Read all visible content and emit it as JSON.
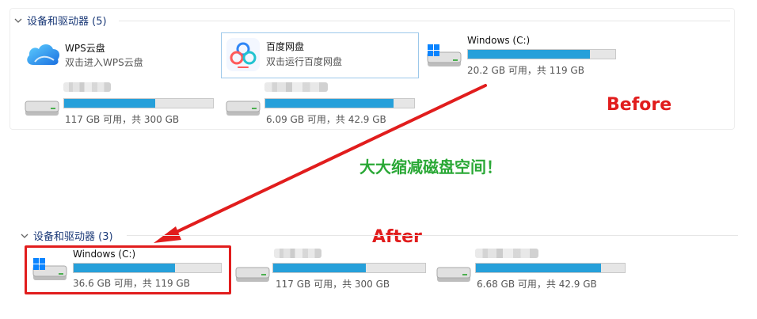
{
  "top_section": {
    "header": "设备和驱动器 (5)",
    "items": [
      {
        "name": "WPS云盘",
        "sub": "双击进入WPS云盘",
        "icon": "wps-cloud-icon"
      },
      {
        "name": "百度网盘",
        "sub": "双击运行百度网盘",
        "icon": "baidu-netdisk-icon"
      },
      {
        "name": "Windows (C:)",
        "space": "20.2 GB 可用，共 119 GB",
        "used_fraction": 0.83,
        "icon": "windows-drive-icon"
      },
      {
        "name": "",
        "space": "117 GB 可用，共 300 GB",
        "used_fraction": 0.61,
        "icon": "drive-icon"
      },
      {
        "name": "",
        "space": "6.09 GB 可用，共 42.9 GB",
        "used_fraction": 0.86,
        "icon": "drive-icon"
      }
    ]
  },
  "bottom_section": {
    "header": "设备和驱动器 (3)",
    "items": [
      {
        "name": "Windows (C:)",
        "space": "36.6 GB 可用，共 119 GB",
        "used_fraction": 0.69,
        "icon": "windows-drive-icon"
      },
      {
        "name": "",
        "space": "117 GB 可用，共 300 GB",
        "used_fraction": 0.61,
        "icon": "drive-icon"
      },
      {
        "name": "",
        "space": "6.68 GB 可用，共 42.9 GB",
        "used_fraction": 0.84,
        "icon": "drive-icon"
      }
    ]
  },
  "annotations": {
    "before": "Before",
    "after": "After",
    "message": "大大缩减磁盘空间！"
  },
  "colors": {
    "bar_fill": "#26a0da",
    "bar_track": "#e6e6e6",
    "header_text": "#1b3a78",
    "annotation_red": "#e11d1d",
    "annotation_green": "#2aa836"
  }
}
